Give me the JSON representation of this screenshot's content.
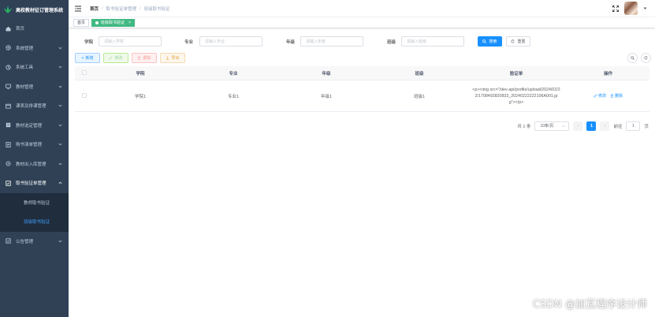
{
  "app": {
    "title": "高校教材征订管理系统"
  },
  "sidebar": {
    "items": [
      {
        "label": "首页",
        "icon": "dashboard-icon"
      },
      {
        "label": "系统管理",
        "icon": "gear-icon"
      },
      {
        "label": "系统工具",
        "icon": "tools-icon"
      },
      {
        "label": "教材管理",
        "icon": "monitor-icon"
      },
      {
        "label": "课表及排课管理",
        "icon": "calendar-icon"
      },
      {
        "label": "教材选定管理",
        "icon": "book-icon"
      },
      {
        "label": "购书清单管理",
        "icon": "list-icon"
      },
      {
        "label": "教材出入库管理",
        "icon": "warehouse-icon"
      },
      {
        "label": "取书验证单管理",
        "icon": "checkbox-icon"
      },
      {
        "label": "公告管理",
        "icon": "notice-icon"
      }
    ],
    "submenu": [
      {
        "label": "教师取书验证"
      },
      {
        "label": "班级取书验证"
      }
    ]
  },
  "header": {
    "breadcrumb": [
      "首页",
      "取书验证单管理",
      "班级取书验证"
    ]
  },
  "tags": [
    {
      "label": "首页"
    },
    {
      "label": "班级取书验证"
    }
  ],
  "search": {
    "fields": [
      {
        "label": "学院",
        "placeholder": "请输入学院"
      },
      {
        "label": "专业",
        "placeholder": "请输入专业"
      },
      {
        "label": "年级",
        "placeholder": "请输入年级"
      },
      {
        "label": "班级",
        "placeholder": "请输入班级"
      }
    ],
    "search_label": "搜索",
    "reset_label": "重置"
  },
  "toolbar": {
    "add_label": "新增",
    "edit_label": "修改",
    "delete_label": "删除",
    "export_label": "导出"
  },
  "table": {
    "columns": [
      "学院",
      "专业",
      "年级",
      "班级",
      "验证单",
      "操作"
    ],
    "rows": [
      {
        "college": "学院1",
        "major": "专业1",
        "grade": "年级1",
        "class": "班级1",
        "proof": "<p><img src=\"/dev-api/profile/upload/2024/02/22/1708492820833_20240222222106A001.jpg\"></p>",
        "edit_label": "修改",
        "delete_label": "删除"
      }
    ]
  },
  "pagination": {
    "total_text": "共 1 条",
    "page_size": "10条/页",
    "current_page": "1",
    "goto_label": "前往",
    "goto_value": "1",
    "page_suffix": "页"
  },
  "watermark": "CSDN @加瓦程序设计师",
  "colors": {
    "sidebar_bg": "#304156",
    "submenu_bg": "#1f2d3d",
    "primary": "#1890ff",
    "tag_active": "#42b983"
  }
}
